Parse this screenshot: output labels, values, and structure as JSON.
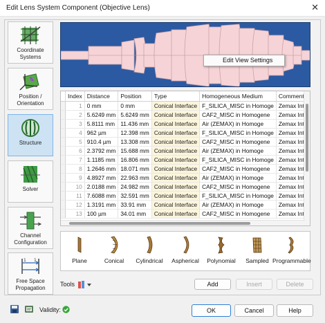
{
  "window": {
    "title": "Edit Lens System Component (Objective Lens)",
    "close_glyph": "✕"
  },
  "sidebar": {
    "items": [
      {
        "label_line1": "Coordinate",
        "label_line2": "Systems",
        "icon": "coordinate-systems-icon",
        "active": false
      },
      {
        "label_line1": "Position /",
        "label_line2": "Orientation",
        "icon": "position-orientation-icon",
        "active": false
      },
      {
        "label_line1": "Structure",
        "label_line2": "",
        "icon": "structure-icon",
        "active": true
      },
      {
        "label_line1": "Solver",
        "label_line2": "",
        "icon": "solver-icon",
        "active": false
      },
      {
        "label_line1": "Channel",
        "label_line2": "Configuration",
        "icon": "channel-configuration-icon",
        "active": false
      },
      {
        "label_line1": "Free Space",
        "label_line2": "Propagation",
        "icon": "free-space-propagation-icon",
        "active": false
      }
    ]
  },
  "viewer": {
    "context_menu_item": "Edit View Settings",
    "background": "#2b5aa2",
    "lens_color": "#f6d3d6"
  },
  "table": {
    "columns": [
      "Index",
      "Distance",
      "Position",
      "Type",
      "Homogeneous Medium",
      "Comment"
    ],
    "rows": [
      {
        "index": "1",
        "distance": "0 mm",
        "position": "0 mm",
        "type": "Conical Interface",
        "medium": "F_SILICA_MISC in Homoge",
        "comment": "Zemax Interf"
      },
      {
        "index": "2",
        "distance": "5.6249 mm",
        "position": "5.6249 mm",
        "type": "Conical Interface",
        "medium": "CAF2_MISC in Homogene",
        "comment": "Zemax Interf"
      },
      {
        "index": "3",
        "distance": "5.8111 mm",
        "position": "11.436 mm",
        "type": "Conical Interface",
        "medium": "Air (ZEMAX) in Homoge",
        "comment": "Zemax Interf"
      },
      {
        "index": "4",
        "distance": "962 µm",
        "position": "12.398 mm",
        "type": "Conical Interface",
        "medium": "F_SILICA_MISC in Homoge",
        "comment": "Zemax Interf"
      },
      {
        "index": "5",
        "distance": "910.4 µm",
        "position": "13.308 mm",
        "type": "Conical Interface",
        "medium": "CAF2_MISC in Homogene",
        "comment": "Zemax Interf"
      },
      {
        "index": "6",
        "distance": "2.3792 mm",
        "position": "15.688 mm",
        "type": "Conical Interface",
        "medium": "Air (ZEMAX) in Homoge",
        "comment": "Zemax Interf"
      },
      {
        "index": "7",
        "distance": "1.1185 mm",
        "position": "16.806 mm",
        "type": "Conical Interface",
        "medium": "F_SILICA_MISC in Homoge",
        "comment": "Zemax Interf"
      },
      {
        "index": "8",
        "distance": "1.2646 mm",
        "position": "18.071 mm",
        "type": "Conical Interface",
        "medium": "CAF2_MISC in Homogene",
        "comment": "Zemax Interf"
      },
      {
        "index": "9",
        "distance": "4.8927 mm",
        "position": "22.963 mm",
        "type": "Conical Interface",
        "medium": "Air (ZEMAX) in Homoge",
        "comment": "Zemax Interf"
      },
      {
        "index": "10",
        "distance": "2.0188 mm",
        "position": "24.982 mm",
        "type": "Conical Interface",
        "medium": "CAF2_MISC in Homogene",
        "comment": "Zemax Interf"
      },
      {
        "index": "11",
        "distance": "7.6088 mm",
        "position": "32.591 mm",
        "type": "Conical Interface",
        "medium": "F_SILICA_MISC in Homoge",
        "comment": "Zemax Interf"
      },
      {
        "index": "12",
        "distance": "1.3191 mm",
        "position": "33.91 mm",
        "type": "Conical Interface",
        "medium": "Air (ZEMAX) in Homoge",
        "comment": "Zemax Interf"
      },
      {
        "index": "13",
        "distance": "100 µm",
        "position": "34.01 mm",
        "type": "Conical Interface",
        "medium": "CAF2_MISC in Homogene",
        "comment": "Zemax Interf"
      }
    ]
  },
  "palette": {
    "items": [
      {
        "label": "Plane",
        "icon": "plane-surface-icon"
      },
      {
        "label": "Conical",
        "icon": "conical-surface-icon"
      },
      {
        "label": "Cylindrical",
        "icon": "cylindrical-surface-icon"
      },
      {
        "label": "Aspherical",
        "icon": "aspherical-surface-icon"
      },
      {
        "label": "Polynomial",
        "icon": "polynomial-surface-icon"
      },
      {
        "label": "Sampled",
        "icon": "sampled-surface-icon"
      },
      {
        "label": "Programmable",
        "icon": "programmable-surface-icon"
      }
    ]
  },
  "tools": {
    "label": "Tools",
    "icon": "tools-icon"
  },
  "actions": {
    "add": "Add",
    "insert": "Insert",
    "delete": "Delete"
  },
  "footer": {
    "validity_label": "Validity:",
    "validity_icon": "check-circle-icon",
    "ok": "OK",
    "cancel": "Cancel",
    "help": "Help",
    "save_icon": "save-icon",
    "open_icon": "open-catalog-icon"
  },
  "colors": {
    "accent": "#2c7fd6",
    "active_nav": "#cde3f4",
    "type_cell": "#fbf5dc",
    "valid_green": "#3aa53a"
  }
}
